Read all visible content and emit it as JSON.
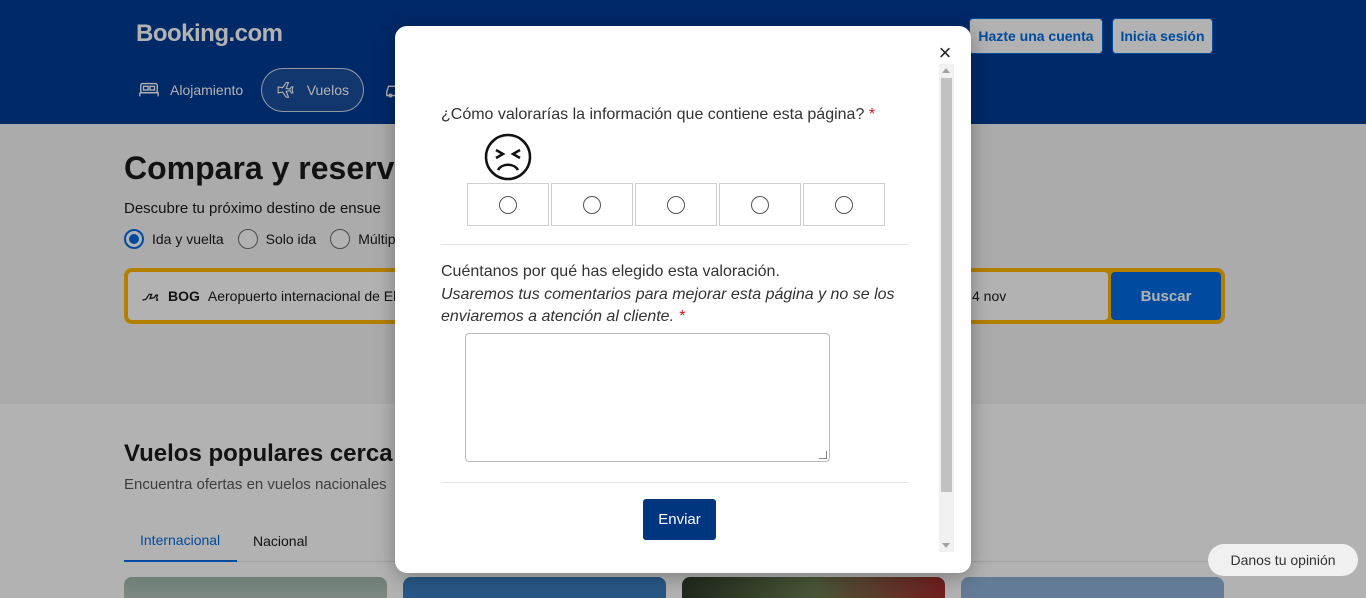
{
  "header": {
    "logo": "Booking.com",
    "register_label": "Hazte una cuenta",
    "signin_label": "Inicia sesión",
    "nav": [
      {
        "label": "Alojamiento"
      },
      {
        "label": "Vuelos"
      }
    ]
  },
  "hero": {
    "title": "Compara y reserva",
    "subtitle": "Descubre tu próximo destino de ensue",
    "trip_types": [
      "Ida y vuelta",
      "Solo ida",
      "Múltip"
    ],
    "origin_code": "BOG",
    "origin_name": "Aeropuerto internacional de El D",
    "date": "4 nov",
    "search_label": "Buscar"
  },
  "popular": {
    "title": "Vuelos populares cerca d",
    "subtitle": "Encuentra ofertas en vuelos nacionales",
    "tabs": [
      "Internacional",
      "Nacional"
    ]
  },
  "feedback_tab": "Danos tu opinión",
  "modal": {
    "question_rating": "¿Cómo valorarías la información que contiene esta página?",
    "required_mark": "*",
    "rating_count": 5,
    "question_reason": "Cuéntanos por qué has elegido esta valoración.",
    "reason_note": "Usaremos tus comentarios para mejorar esta página y no se los enviaremos a atención al cliente.",
    "submit_label": "Enviar",
    "close_glyph": "×"
  },
  "colors": {
    "brand_blue": "#003b95",
    "accent_blue": "#006ce4",
    "search_yellow": "#ffb700",
    "submit_blue": "#003580"
  }
}
